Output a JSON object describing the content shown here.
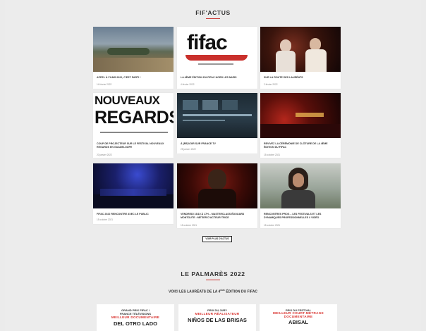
{
  "actus": {
    "heading": "FIF'ACTUS",
    "more_label": "VOIR PLUS D'ACTUS",
    "cards": [
      {
        "title": "APPEL À FILMS 2022, C'EST PARTI !",
        "date": "14 février 2022"
      },
      {
        "title": "LA 4ÈME ÉDITION DU FIFAC HORS LES MURS",
        "date": "4 février 2022"
      },
      {
        "title": "SUR LA ROUTE DES LAURÉATS",
        "date": "2 février 2022"
      },
      {
        "title": "COUP DE PROJECTEUR SUR LE FESTIVAL NOUVEAUX REGARDS EN GUADELOUPE",
        "date": "20 janvier 2022"
      },
      {
        "title": "À (RE)VOIR SUR FRANCE TV",
        "date": "25 janvier 2022"
      },
      {
        "title": "REVIVEZ LA CÉRÉMONIE DE CLÔTURE DE LA 4ÈME ÉDITION DU FIFAC",
        "date": "15 octobre 2021"
      },
      {
        "title": "FIFAC 2022 RENCONTRE AVEC LE PUBLIC",
        "date": "15 octobre 2021"
      },
      {
        "title": "VENDREDI 16/10 À 17H – MASTERCLASS ÉDOUARD MONTOUTE : MÉTIER D'ACTEUR·TRICE",
        "date": "15 octobre 2021"
      },
      {
        "title": "RENCONTRES PROS – LES FESTIVALS ET LES DYNAMIQUES PROFESSIONNELLES // VIDÉO",
        "date": "15 octobre 2021"
      }
    ],
    "logos": {
      "fifac": "fifac",
      "nouveaux": "NOUVEAUX",
      "regards": "REGARDS"
    }
  },
  "palmares": {
    "heading": "LE PALMARÈS 2022",
    "subtitle_before": "VOICI LES LAURÉATS DE LA 4",
    "subtitle_sup": "ÈME",
    "subtitle_after": " ÉDITION DU FIFAC",
    "prizes": [
      {
        "line1": "GRAND PRIX FIFAC /",
        "line1b": "FRANCE TÉLÉVISIONS",
        "category": "MEILLEUR DOCUMENTAIRE",
        "film": "DEL OTRO LADO"
      },
      {
        "line1": "PRIX DU JURY",
        "line1b": "",
        "category": "MEILLEUR RÉALISATEUR",
        "film": "NIÑOS DE LAS BRISAS"
      },
      {
        "line1": "PRIX DU FESTIVAL",
        "line1b": "",
        "category": "MEILLEUR COURT-MÉTRAGE DOCUMENTAIRE",
        "film": "ABISAL"
      }
    ]
  },
  "colors": {
    "accent": "#d8302c",
    "background": "#ececec"
  }
}
